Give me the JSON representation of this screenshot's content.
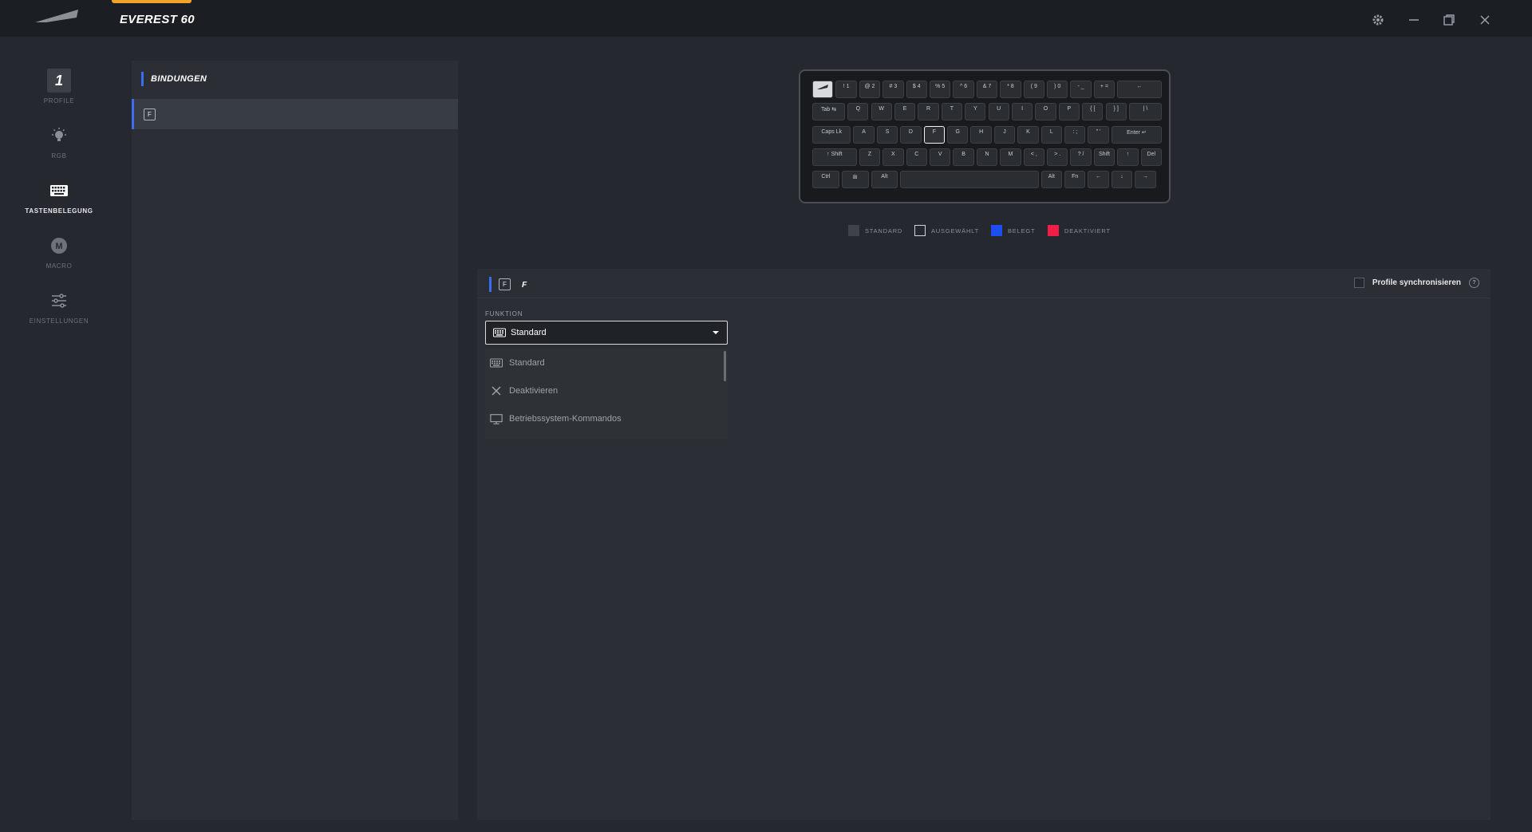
{
  "app": {
    "title": "EVEREST 60"
  },
  "window_controls": [
    "gear-icon",
    "minimize-icon",
    "maximize-icon",
    "close-icon"
  ],
  "sidebar": {
    "profile_number": "1",
    "items": [
      {
        "label": "PROFILE",
        "icon": "profile-number"
      },
      {
        "label": "RGB",
        "icon": "bulb-icon"
      },
      {
        "label": "TASTENBELEGUNG",
        "icon": "keyboard-icon",
        "active": true
      },
      {
        "label": "MACRO",
        "icon": "macro-icon"
      },
      {
        "label": "EINSTELLUNGEN",
        "icon": "sliders-icon"
      }
    ]
  },
  "bindings": {
    "header": "BINDUNGEN",
    "selected_key": "F"
  },
  "keyboard": {
    "rows": [
      [
        "",
        "! 1",
        "@ 2",
        "# 3",
        "$ 4",
        "% 5",
        "^ 6",
        "& 7",
        "* 8",
        "( 9",
        ") 0",
        "- _",
        "+ =",
        "←"
      ],
      [
        "Tab ⇆",
        "Q",
        "W",
        "E",
        "R",
        "T",
        "Y",
        "U",
        "I",
        "O",
        "P",
        "{ [",
        "} ]",
        "| \\"
      ],
      [
        "Caps Lk",
        "A",
        "S",
        "D",
        "F",
        "G",
        "H",
        "J",
        "K",
        "L",
        ": ;",
        "\" '",
        "Enter ↵"
      ],
      [
        "↑ Shift",
        "Z",
        "X",
        "C",
        "V",
        "B",
        "N",
        "M",
        "< ,",
        "> .",
        "? /",
        "Shift",
        "↑",
        "Del"
      ],
      [
        "Ctrl",
        "⊞",
        "Alt",
        "",
        "Alt",
        "Fn",
        "←",
        "↓",
        "→"
      ]
    ],
    "selected": "F"
  },
  "legend": [
    {
      "label": "STANDARD",
      "color": "#3e4249"
    },
    {
      "label": "AUSGEWÄHLT",
      "color": "transparent"
    },
    {
      "label": "BELEGT",
      "color": "#1e4df0"
    },
    {
      "label": "DEAKTIVIERT",
      "color": "#f01e46"
    }
  ],
  "detail": {
    "key_chip": "F",
    "key_name": "F",
    "sync_label": "Profile synchronisieren",
    "help": "?",
    "function_label": "FUNKTION",
    "selected_function": "Standard",
    "options": [
      {
        "label": "Standard",
        "icon": "keyboard-icon"
      },
      {
        "label": "Deaktivieren",
        "icon": "x-icon"
      },
      {
        "label": "Betriebssystem-Kommandos",
        "icon": "monitor-icon"
      }
    ]
  },
  "colors": {
    "accent": "#f0a229",
    "selection_bar": "#3a6df0"
  }
}
